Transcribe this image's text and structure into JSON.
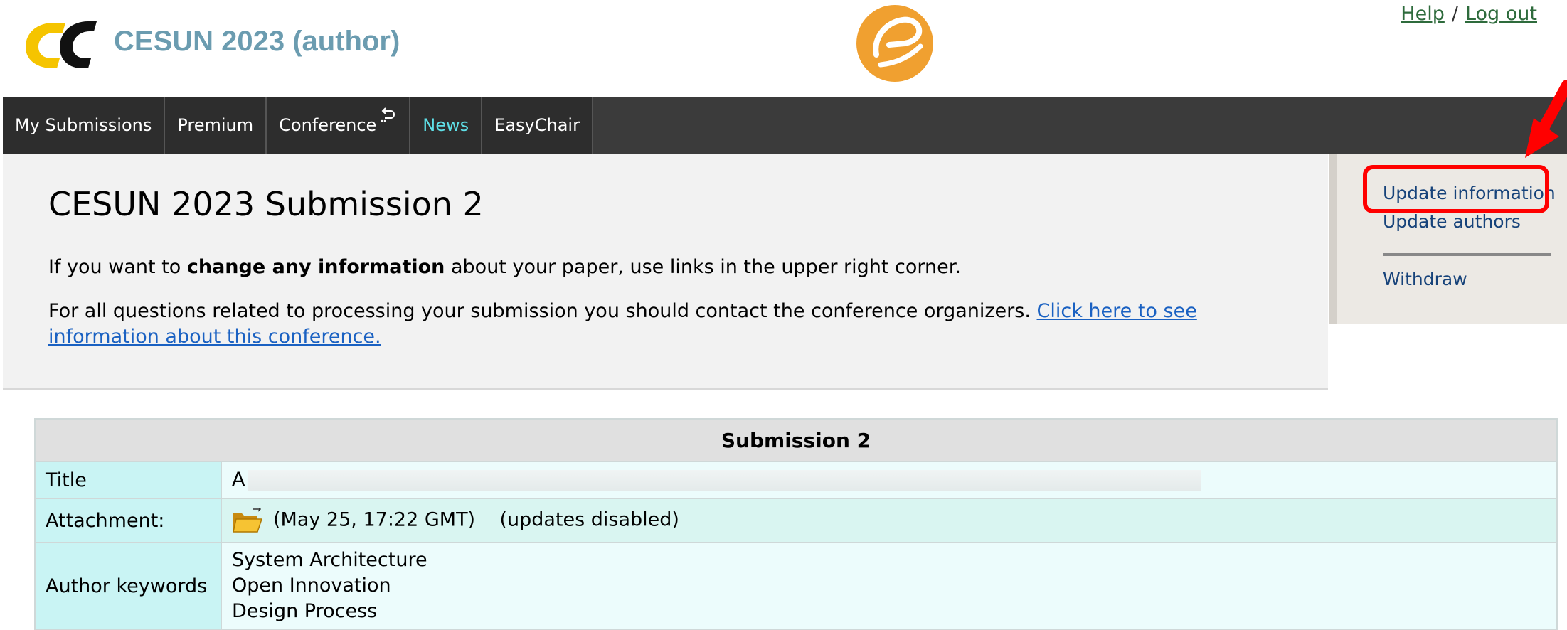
{
  "header": {
    "app_title": "CESUN 2023 (author)",
    "logo_icon": "easychair-logo-icon",
    "center_logo_icon": "easychair-orange-emblem-icon",
    "help_link": "Help",
    "separator": "/",
    "logout_link": "Log out"
  },
  "nav": {
    "tabs": [
      "My Submissions",
      "Premium",
      "Conference",
      "News",
      "EasyChair"
    ],
    "active_tab": "News",
    "active_color": "#5fe0e8"
  },
  "main": {
    "title": "CESUN 2023 Submission 2",
    "intro_prefix": "If you want to",
    "intro_bold": "change any information",
    "intro_suffix": "about your paper, use links in the upper right corner.",
    "contact_text": "For all questions related to processing your submission you should contact the conference organizers.",
    "contact_link": "Click here to see information about this conference."
  },
  "side_menu": {
    "update_information": "Update information",
    "update_authors": "Update authors",
    "withdraw": "Withdraw",
    "highlight_color": "#ff0000"
  },
  "submission": {
    "header": "Submission 2",
    "title_label": "Title",
    "title_value_visible": "A",
    "attachment_label": "Attachment:",
    "attachment_icon": "folder-icon",
    "attachment_date": "(May 25, 17:22 GMT)",
    "attachment_status": "(updates disabled)",
    "keywords_label": "Author keywords",
    "keywords": [
      "System Architecture",
      "Open Innovation",
      "Design Process"
    ]
  }
}
